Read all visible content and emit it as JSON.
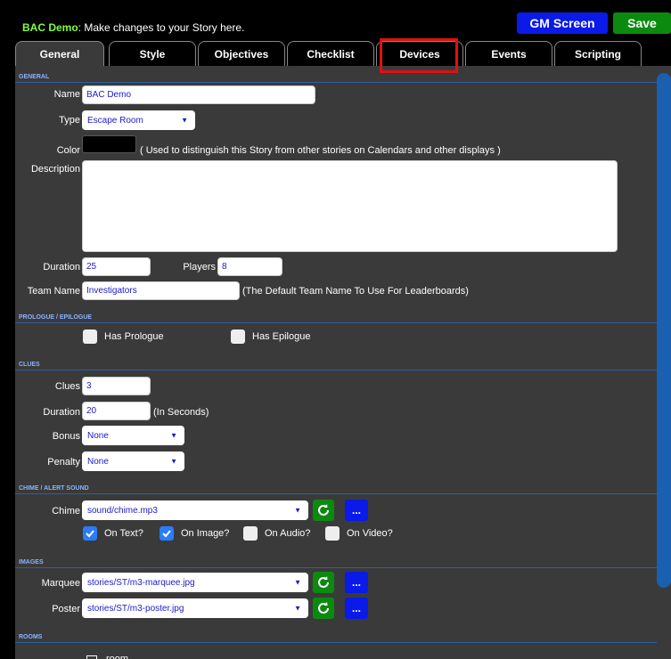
{
  "header": {
    "brand": "BAC Demo",
    "title_suffix": ": Make changes to your Story here.",
    "gm_screen_label": "GM Screen",
    "save_label": "Save"
  },
  "tabs": [
    {
      "label": "General",
      "active": true
    },
    {
      "label": "Style",
      "active": false
    },
    {
      "label": "Objectives",
      "active": false
    },
    {
      "label": "Checklist",
      "active": false
    },
    {
      "label": "Devices",
      "active": false
    },
    {
      "label": "Events",
      "active": false
    },
    {
      "label": "Scripting",
      "active": false
    }
  ],
  "general": {
    "section_title": "GENERAL",
    "name_label": "Name",
    "name_value": "BAC Demo",
    "type_label": "Type",
    "type_value": "Escape Room",
    "color_label": "Color",
    "color_value": "#000000",
    "color_note": "( Used to distinguish this Story from other stories on Calendars and other displays )",
    "description_label": "Description",
    "description_value": "",
    "duration_label": "Duration",
    "duration_value": "25",
    "players_label": "Players",
    "players_value": "8",
    "team_name_label": "Team Name",
    "team_name_value": "Investigators",
    "team_name_note": "(The Default Team Name To Use For Leaderboards)"
  },
  "prologue": {
    "section_title": "PROLOGUE / EPILOGUE",
    "has_prologue_label": "Has Prologue",
    "has_prologue": false,
    "has_epilogue_label": "Has Epilogue",
    "has_epilogue": false
  },
  "clues": {
    "section_title": "CLUES",
    "clues_label": "Clues",
    "clues_value": "3",
    "duration_label": "Duration",
    "duration_value": "20",
    "duration_note": "(In Seconds)",
    "bonus_label": "Bonus",
    "bonus_value": "None",
    "penalty_label": "Penalty",
    "penalty_value": "None"
  },
  "chime": {
    "section_title": "CHIME / ALERT SOUND",
    "chime_label": "Chime",
    "chime_value": "sound/chime.mp3",
    "on_text_label": "On Text?",
    "on_text": true,
    "on_image_label": "On Image?",
    "on_image": true,
    "on_audio_label": "On Audio?",
    "on_audio": false,
    "on_video_label": "On Video?",
    "on_video": false
  },
  "images": {
    "section_title": "IMAGES",
    "marquee_label": "Marquee",
    "marquee_value": "stories/ST/m3-marquee.jpg",
    "poster_label": "Poster",
    "poster_value": "stories/ST/m3-poster.jpg"
  },
  "rooms": {
    "section_title": "ROOMS",
    "room_label": "room"
  },
  "dots_label": "...",
  "colors": {
    "accent_blue": "#0a1ae8",
    "save_green": "#0c8a10",
    "brand_green": "#80ff40",
    "highlight_red": "#e01010",
    "section_blue": "#8ab4ff"
  },
  "icons": {
    "refresh": "refresh-icon",
    "more": "ellipsis-icon",
    "caret": "caret-down-icon",
    "check": "check-icon"
  }
}
